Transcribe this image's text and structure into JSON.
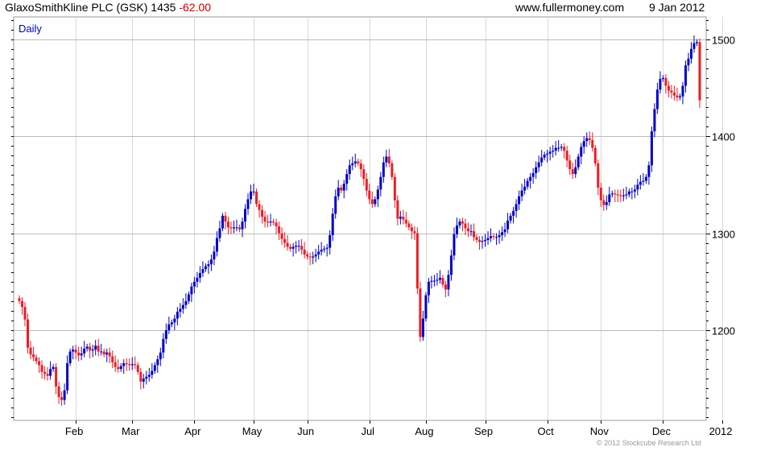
{
  "header": {
    "symbol": "GlaxoSmithKline PLC (GSK)",
    "price": "1435",
    "change": "-62.00",
    "site": "www.fullermoney.com",
    "date": "9 Jan 2012"
  },
  "footer": {
    "copyright": "© 2012 Stockcube Research Ltd"
  },
  "colors": {
    "up": "#0000cc",
    "down": "#ee1c25",
    "grid": "#d8d8d8",
    "frame": "#999999",
    "text": "#000000",
    "period_label": "#0000cc"
  },
  "chart_data": {
    "type": "candlestick",
    "period_label": "Daily",
    "ylim": [
      1107,
      1523
    ],
    "ytick_values": [
      1200,
      1300,
      1400,
      1500
    ],
    "ytick_labels": [
      "1200",
      "1300",
      "1400",
      "1500"
    ],
    "x_months": [
      {
        "label": "Feb",
        "index": 20
      },
      {
        "label": "Mar",
        "index": 40
      },
      {
        "label": "Apr",
        "index": 62
      },
      {
        "label": "May",
        "index": 83
      },
      {
        "label": "Jun",
        "index": 102
      },
      {
        "label": "Jul",
        "index": 124
      },
      {
        "label": "Aug",
        "index": 144
      },
      {
        "label": "Sep",
        "index": 165
      },
      {
        "label": "Oct",
        "index": 187
      },
      {
        "label": "Nov",
        "index": 206
      },
      {
        "label": "Dec",
        "index": 228
      },
      {
        "label": "2012",
        "index": 249
      }
    ],
    "close": [
      1230,
      1224,
      1211,
      1182,
      1175,
      1172,
      1168,
      1164,
      1157,
      1155,
      1153,
      1160,
      1162,
      1142,
      1131,
      1128,
      1138,
      1166,
      1178,
      1180,
      1177,
      1174,
      1176,
      1181,
      1183,
      1179,
      1180,
      1184,
      1178,
      1178,
      1175,
      1177,
      1173,
      1167,
      1162,
      1160,
      1163,
      1166,
      1165,
      1164,
      1165,
      1164,
      1157,
      1147,
      1150,
      1152,
      1154,
      1158,
      1164,
      1170,
      1177,
      1191,
      1200,
      1206,
      1208,
      1212,
      1219,
      1222,
      1226,
      1230,
      1237,
      1245,
      1250,
      1254,
      1259,
      1263,
      1266,
      1268,
      1273,
      1281,
      1295,
      1305,
      1318,
      1312,
      1306,
      1305,
      1306,
      1306,
      1304,
      1312,
      1325,
      1335,
      1343,
      1343,
      1330,
      1324,
      1317,
      1312,
      1311,
      1312,
      1311,
      1307,
      1300,
      1294,
      1290,
      1286,
      1284,
      1286,
      1287,
      1287,
      1283,
      1278,
      1276,
      1275,
      1276,
      1278,
      1281,
      1283,
      1284,
      1285,
      1298,
      1320,
      1338,
      1347,
      1344,
      1351,
      1361,
      1370,
      1372,
      1374,
      1372,
      1366,
      1356,
      1344,
      1335,
      1330,
      1335,
      1345,
      1358,
      1373,
      1379,
      1372,
      1358,
      1334,
      1315,
      1317,
      1314,
      1310,
      1306,
      1302,
      1300,
      1243,
      1193,
      1212,
      1236,
      1250,
      1251,
      1251,
      1252,
      1254,
      1247,
      1242,
      1257,
      1277,
      1299,
      1308,
      1312,
      1310,
      1305,
      1302,
      1302,
      1296,
      1293,
      1291,
      1292,
      1293,
      1295,
      1297,
      1296,
      1296,
      1298,
      1301,
      1304,
      1313,
      1318,
      1323,
      1330,
      1338,
      1344,
      1348,
      1354,
      1358,
      1362,
      1368,
      1373,
      1378,
      1381,
      1382,
      1384,
      1385,
      1388,
      1388,
      1389,
      1385,
      1375,
      1366,
      1361,
      1368,
      1379,
      1389,
      1395,
      1398,
      1396,
      1388,
      1372,
      1347,
      1334,
      1329,
      1332,
      1340,
      1341,
      1340,
      1339,
      1338,
      1339,
      1340,
      1343,
      1343,
      1345,
      1350,
      1353,
      1354,
      1358,
      1370,
      1405,
      1428,
      1448,
      1459,
      1460,
      1452,
      1447,
      1445,
      1442,
      1440,
      1441,
      1452,
      1473,
      1480,
      1490,
      1496,
      1497,
      1437
    ]
  }
}
